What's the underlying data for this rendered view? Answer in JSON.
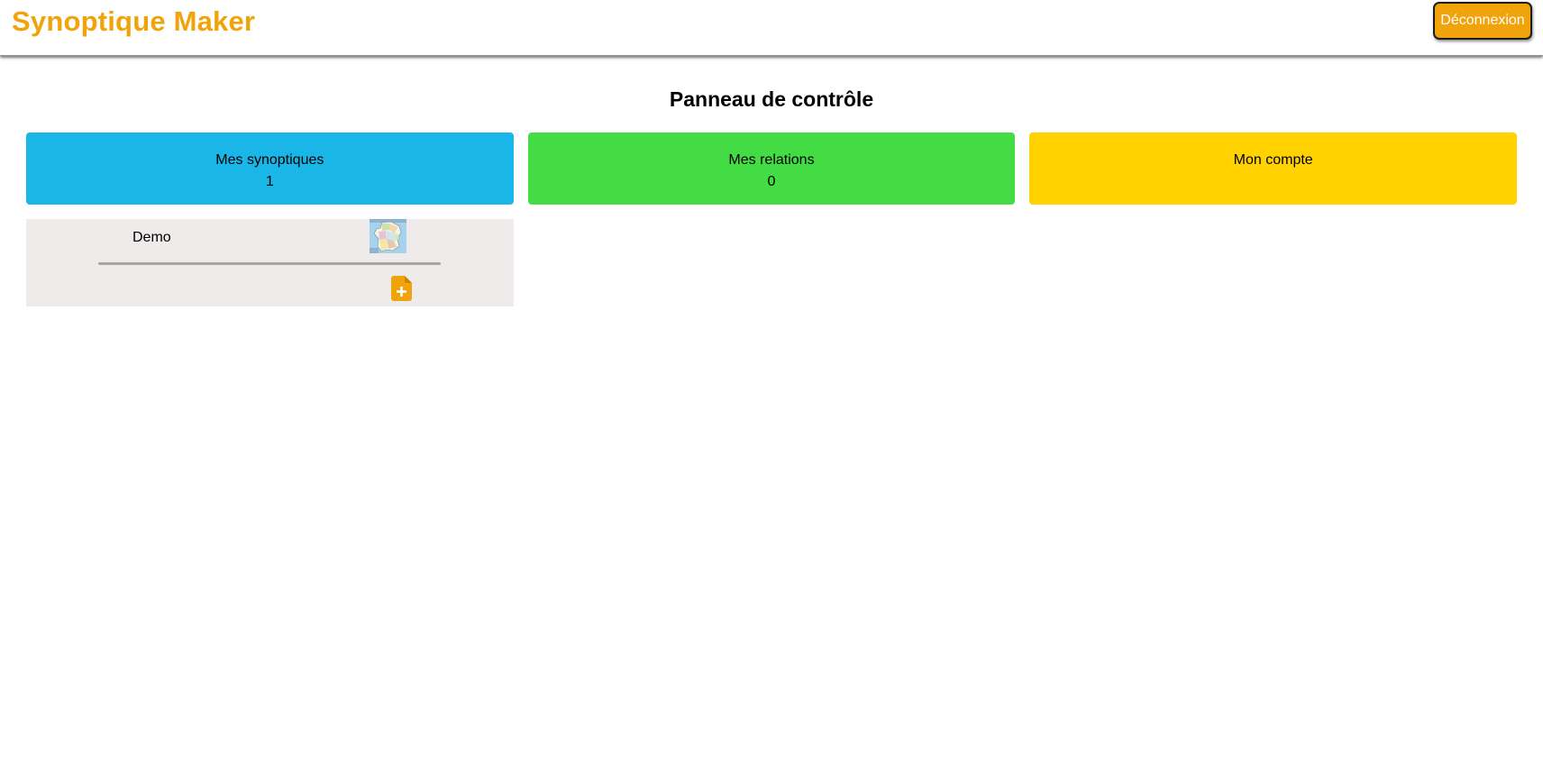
{
  "header": {
    "brand": "Synoptique Maker",
    "logout_label": "Déconnexion"
  },
  "main": {
    "title": "Panneau de contrôle",
    "cards": [
      {
        "label": "Mes synoptiques",
        "count": "1",
        "color": "#1ab6e8"
      },
      {
        "label": "Mes relations",
        "count": "0",
        "color": "#44dc44"
      },
      {
        "label": "Mon compte",
        "count": "",
        "color": "#ffd200"
      }
    ],
    "synoptics": [
      {
        "name": "Demo",
        "thumbnail_icon": "france-map-thumbnail",
        "action_icon": "file-add-icon"
      }
    ]
  },
  "colors": {
    "brand": "#f0a30a",
    "panel_bg": "#eeebea"
  }
}
